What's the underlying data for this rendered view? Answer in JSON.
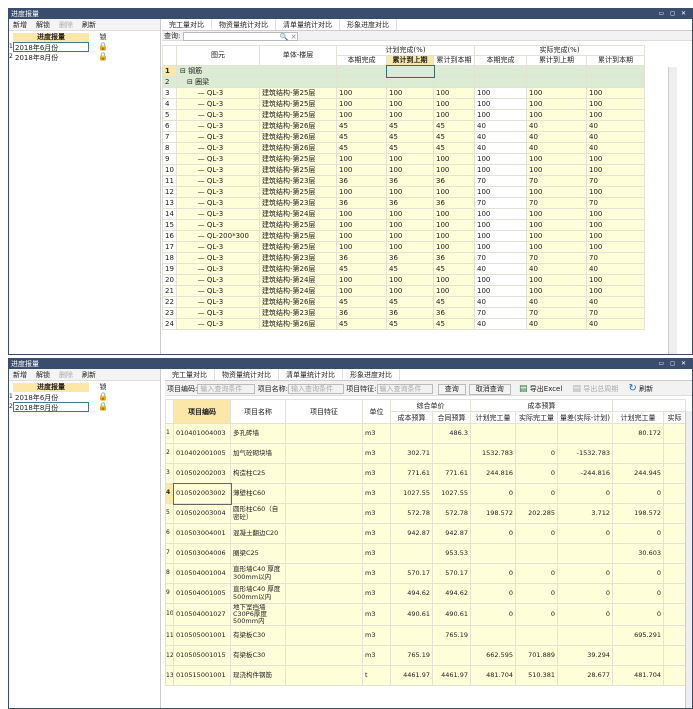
{
  "colors": {
    "titlebar": "#3b4d6e",
    "highlight": "#fbe7a8",
    "row_yellow": "#fefed8",
    "row_green": "#dcebd3",
    "lock": "#e04a2a"
  },
  "window_title": "进度报量",
  "window_controls": "▭ ◻ ✕",
  "toolbar": {
    "new": "新增",
    "unlock": "解锁",
    "delete": "删除",
    "refresh": "刷新"
  },
  "progress_panel": {
    "col_name": "进度报量",
    "col_lock": "锁",
    "lock_icon": "🔒",
    "items": [
      {
        "n": "1",
        "label": "2018年6月份"
      },
      {
        "n": "2",
        "label": "2018年8月份"
      }
    ]
  },
  "tabs": [
    "完工量对比",
    "物资量统计对比",
    "清单量统计对比",
    "形象进度对比"
  ],
  "top": {
    "query_label": "查询:",
    "search_icons": "🔍 ✕",
    "headers": {
      "element": "图元",
      "floor": "单体-楼层",
      "plan_group": "计划完成(%)",
      "actual_group": "实际完成(%)",
      "this": "本期完成",
      "to_last": "累计到上期",
      "to_this": "累计到本期"
    },
    "group_rows": [
      {
        "n": "1",
        "label": "钢筋"
      },
      {
        "n": "2",
        "label": "圈梁"
      }
    ],
    "rows": [
      [
        "3",
        "QL-3",
        "建筑结构-第25层",
        "100",
        "100",
        "100",
        "100",
        "100",
        "100"
      ],
      [
        "4",
        "QL-3",
        "建筑结构-第25层",
        "100",
        "100",
        "100",
        "100",
        "100",
        "100"
      ],
      [
        "5",
        "QL-3",
        "建筑结构-第25层",
        "100",
        "100",
        "100",
        "100",
        "100",
        "100"
      ],
      [
        "6",
        "QL-3",
        "建筑结构-第26层",
        "45",
        "45",
        "45",
        "40",
        "40",
        "40"
      ],
      [
        "7",
        "QL-3",
        "建筑结构-第26层",
        "45",
        "45",
        "45",
        "40",
        "40",
        "40"
      ],
      [
        "8",
        "QL-3",
        "建筑结构-第26层",
        "45",
        "45",
        "45",
        "40",
        "40",
        "40"
      ],
      [
        "9",
        "QL-3",
        "建筑结构-第25层",
        "100",
        "100",
        "100",
        "100",
        "100",
        "100"
      ],
      [
        "10",
        "QL-3",
        "建筑结构-第25层",
        "100",
        "100",
        "100",
        "100",
        "100",
        "100"
      ],
      [
        "11",
        "QL-3",
        "建筑结构-第23层",
        "36",
        "36",
        "36",
        "70",
        "70",
        "70"
      ],
      [
        "12",
        "QL-3",
        "建筑结构-第25层",
        "100",
        "100",
        "100",
        "100",
        "100",
        "100"
      ],
      [
        "13",
        "QL-3",
        "建筑结构-第23层",
        "36",
        "36",
        "36",
        "70",
        "70",
        "70"
      ],
      [
        "14",
        "QL-3",
        "建筑结构-第24层",
        "100",
        "100",
        "100",
        "100",
        "100",
        "100"
      ],
      [
        "15",
        "QL-3",
        "建筑结构-第25层",
        "100",
        "100",
        "100",
        "100",
        "100",
        "100"
      ],
      [
        "16",
        "QL-200*300",
        "建筑结构-第25层",
        "100",
        "100",
        "100",
        "100",
        "100",
        "100"
      ],
      [
        "17",
        "QL-3",
        "建筑结构-第25层",
        "100",
        "100",
        "100",
        "100",
        "100",
        "100"
      ],
      [
        "18",
        "QL-3",
        "建筑结构-第23层",
        "36",
        "36",
        "36",
        "70",
        "70",
        "70"
      ],
      [
        "19",
        "QL-3",
        "建筑结构-第26层",
        "45",
        "45",
        "45",
        "40",
        "40",
        "40"
      ],
      [
        "20",
        "QL-3",
        "建筑结构-第24层",
        "100",
        "100",
        "100",
        "100",
        "100",
        "100"
      ],
      [
        "21",
        "QL-3",
        "建筑结构-第24层",
        "100",
        "100",
        "100",
        "100",
        "100",
        "100"
      ],
      [
        "22",
        "QL-3",
        "建筑结构-第26层",
        "45",
        "45",
        "45",
        "40",
        "40",
        "40"
      ],
      [
        "23",
        "QL-3",
        "建筑结构-第23层",
        "36",
        "36",
        "36",
        "70",
        "70",
        "70"
      ],
      [
        "24",
        "QL-3",
        "建筑结构-第26层",
        "45",
        "45",
        "45",
        "40",
        "40",
        "40"
      ]
    ]
  },
  "bottom": {
    "query": {
      "code_label": "项目编码:",
      "name_label": "项目名称:",
      "feature_label": "项目特征:",
      "placeholder": "输入查询条件",
      "search": "查询",
      "cancel": "取消查询",
      "export": "导出Excel",
      "export_total": "导出总周期",
      "refresh": "刷新"
    },
    "headers": {
      "code": "项目编码",
      "name": "项目名称",
      "feature": "项目特征",
      "unit": "单位",
      "unit_price": "综合单价",
      "cost_budget": "成本预算",
      "cost": "成本预算",
      "contract": "合同预算",
      "plan": "计划完工量",
      "actual": "实际完工量",
      "diff": "量差(实际-计划)",
      "plan2": "计划完工量",
      "actual2": "实际"
    },
    "rows": [
      [
        "1",
        "010401004003",
        "多孔砖墙",
        "m3",
        "",
        "486.3",
        "",
        "",
        "",
        "80.172"
      ],
      [
        "2",
        "010402001005",
        "加气砼砌块墙",
        "m3",
        "302.71",
        "",
        "1532.783",
        "0",
        "-1532.783",
        ""
      ],
      [
        "3",
        "010502002003",
        "构造柱C25",
        "m3",
        "771.61",
        "771.61",
        "244.816",
        "0",
        "-244.816",
        "244.945"
      ],
      [
        "4",
        "010502003002",
        "薄壁柱C60",
        "m3",
        "1027.55",
        "1027.55",
        "0",
        "0",
        "0",
        "0"
      ],
      [
        "5",
        "010502003004",
        "圆形柱C60（自密砼）",
        "m3",
        "572.78",
        "572.78",
        "198.572",
        "202.285",
        "3.712",
        "198.572"
      ],
      [
        "6",
        "010503004001",
        "混凝土翻边C20",
        "m3",
        "942.87",
        "942.87",
        "0",
        "0",
        "0",
        "0"
      ],
      [
        "7",
        "010503004006",
        "圈梁C25",
        "m3",
        "",
        "953.53",
        "",
        "",
        "",
        "30.603"
      ],
      [
        "8",
        "010504001004",
        "直形墙C40 厚度300mm以内",
        "m3",
        "570.17",
        "570.17",
        "0",
        "0",
        "0",
        "0"
      ],
      [
        "9",
        "010504001005",
        "直形墙C40 厚度500mm以内",
        "m3",
        "494.62",
        "494.62",
        "0",
        "0",
        "0",
        "0"
      ],
      [
        "10",
        "010504001027",
        "地下室挡墙C30P6厚度500mm内",
        "m3",
        "490.61",
        "490.61",
        "0",
        "0",
        "0",
        "0"
      ],
      [
        "11",
        "010505001001",
        "有梁板C30",
        "m3",
        "",
        "765.19",
        "",
        "",
        "",
        "695.291"
      ],
      [
        "12",
        "010505001015",
        "有梁板C30",
        "m3",
        "765.19",
        "",
        "662.595",
        "701.889",
        "39.294",
        ""
      ],
      [
        "13",
        "010515001001",
        "现浇构件钢筋",
        "t",
        "4461.97",
        "4461.97",
        "481.704",
        "510.381",
        "28.677",
        "481.704"
      ]
    ]
  }
}
